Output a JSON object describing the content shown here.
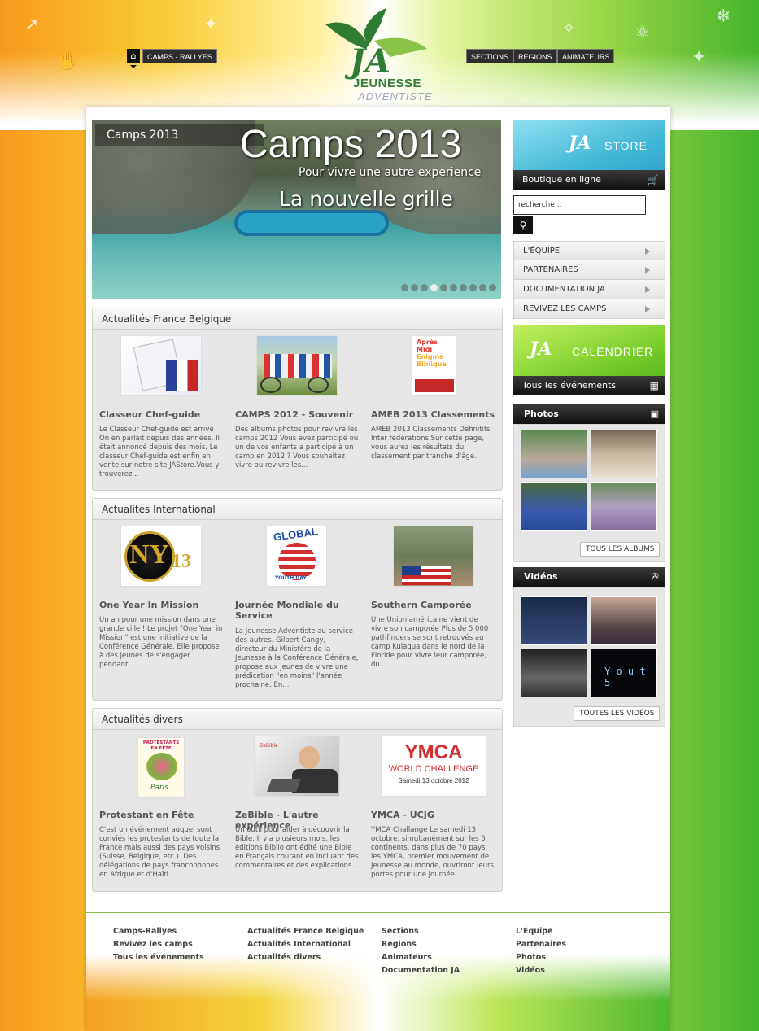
{
  "header": {
    "home_icon": "home-icon",
    "nav_left": [
      "CAMPS - RALLYES"
    ],
    "nav_right": [
      "SECTIONS",
      "REGIONS",
      "ANIMATEURS"
    ],
    "logo": {
      "mark": "JA",
      "line1": "JEUNESSE",
      "line2": "ADVENTISTE"
    }
  },
  "slider": {
    "label": "Camps 2013",
    "title": "Camps 2013",
    "subtitle": "Pour vivre une autre experience",
    "tagline": "La nouvelle grille",
    "dot_count": 10,
    "active_dot": 3
  },
  "sections": [
    {
      "title": "Actualités France Belgique",
      "articles": [
        {
          "title": "Classeur Chef-guide",
          "text": "Le Classeur Chef-guide est arrivé On en parlait depuis des années. Il était annoncé depuis des mois. Le classeur Chef-guide est enfin en vente sur notre site JAStore.Vous y trouverez..."
        },
        {
          "title": "CAMPS 2012 - Souvenir",
          "text": "Des albums photos pour revivre les camps 2012 Vous avez participé ou un de vos enfants a participé à un camp en 2012 ? Vous souhaitez vivre ou revivre les..."
        },
        {
          "title": "AMEB 2013 Classements",
          "text": "AMEB 2013 Classements Définitifs Inter fédérations Sur cette page, vous aurez les résultats du classement par tranche d'âge.",
          "img_text": [
            "Après",
            "Midi",
            "Enigme",
            "Biblique"
          ]
        }
      ]
    },
    {
      "title": "Actualités International",
      "articles": [
        {
          "title": "One Year In Mission",
          "text": "Un an pour une mission dans une grande ville ! Le projet \"One Year in Mission\" est une initiative de la Conférence Générale. Elle propose à des jeunes de s'engager pendant...",
          "img_text": [
            "NY",
            "13"
          ]
        },
        {
          "title": "Journée Mondiale du Service",
          "text": "La Jeunesse Adventiste au service des autres. Gilbert Cangy, directeur du Ministère de la Jeunesse à la Conférence Générale, propose aux jeunes de vivre une prédication \"en moins\" l'année prochaine. En...",
          "img_text": [
            "GLOBAL",
            "YOUTH DAY"
          ]
        },
        {
          "title": "Southern Camporée",
          "text": "Une Union américaine vient de vivre son camporée Plus de 5 000 pathfinders se sont retrouvés au camp Kulaqua dans le nord de la Floride pour vivre leur camporée, du..."
        }
      ]
    },
    {
      "title": "Actualités divers",
      "articles": [
        {
          "title": "Protestant en Fête",
          "text": "C'est un événement auquel sont conviés les protestants de toute la France mais aussi des pays voisins (Suisse, Belgique, etc.). Des délégations de pays francophones en Afrique et d'Haïti...",
          "img_text": [
            "PROTESTANTS",
            "EN FÊTE",
            "Paris"
          ]
        },
        {
          "title": "ZeBible - L'autre expérience",
          "text": "Un outil pour aider à découvrir la Bible. Il y a plusieurs mois, les éditions Biblio ont édité une Bible en Français courant en incluant des commentaires et des explications...",
          "img_text": [
            "ZeBible"
          ]
        },
        {
          "title": "YMCA - UCJG",
          "text": "YMCA Challange Le samedi 13 octobre, simultanément sur les 5 continents, dans plus de 70 pays, les YMCA, premier mouvement de jeunesse au monde, ouvriront leurs portes pour une journée...",
          "img_text": [
            "YMCA",
            "WORLD CHALLENGE",
            "Samedi 13 octobre 2012"
          ]
        }
      ]
    }
  ],
  "sidebar": {
    "store": {
      "mark": "JA",
      "word": "STORE",
      "bar": "Boutique en ligne",
      "icon": "cart-icon"
    },
    "search_placeholder": "recherche...",
    "search_icon": "search-icon",
    "menu": [
      "L'ÉQUIPE",
      "PARTENAIRES",
      "DOCUMENTATION JA",
      "REVIVEZ LES CAMPS"
    ],
    "calendar": {
      "mark": "JA",
      "word": "CALENDRIER",
      "bar": "Tous les événements",
      "icon": "calendar-icon"
    },
    "photos": {
      "title": "Photos",
      "icon": "image-icon",
      "button": "TOUS LES ALBUMS"
    },
    "videos": {
      "title": "Vidéos",
      "icon": "film-reel-icon",
      "button": "TOUTES LES VIDÉOS",
      "thumb_text": "Y o u t 5"
    }
  },
  "footer": {
    "columns": [
      [
        "Camps-Rallyes",
        "Revivez les camps",
        "Tous les événements"
      ],
      [
        "Actualités France Belgique",
        "Actualités International",
        "Actualités divers"
      ],
      [
        "Sections",
        "Regions",
        "Animateurs",
        "Documentation JA"
      ],
      [
        "L'Équipe",
        "Partenaires",
        "Photos",
        "Vidéos"
      ]
    ]
  },
  "colors": {
    "accent_green": "#4caa1b",
    "accent_blue": "#3fb5d6",
    "accent_orange": "#f79a1c",
    "dark_bar": "#111111"
  }
}
